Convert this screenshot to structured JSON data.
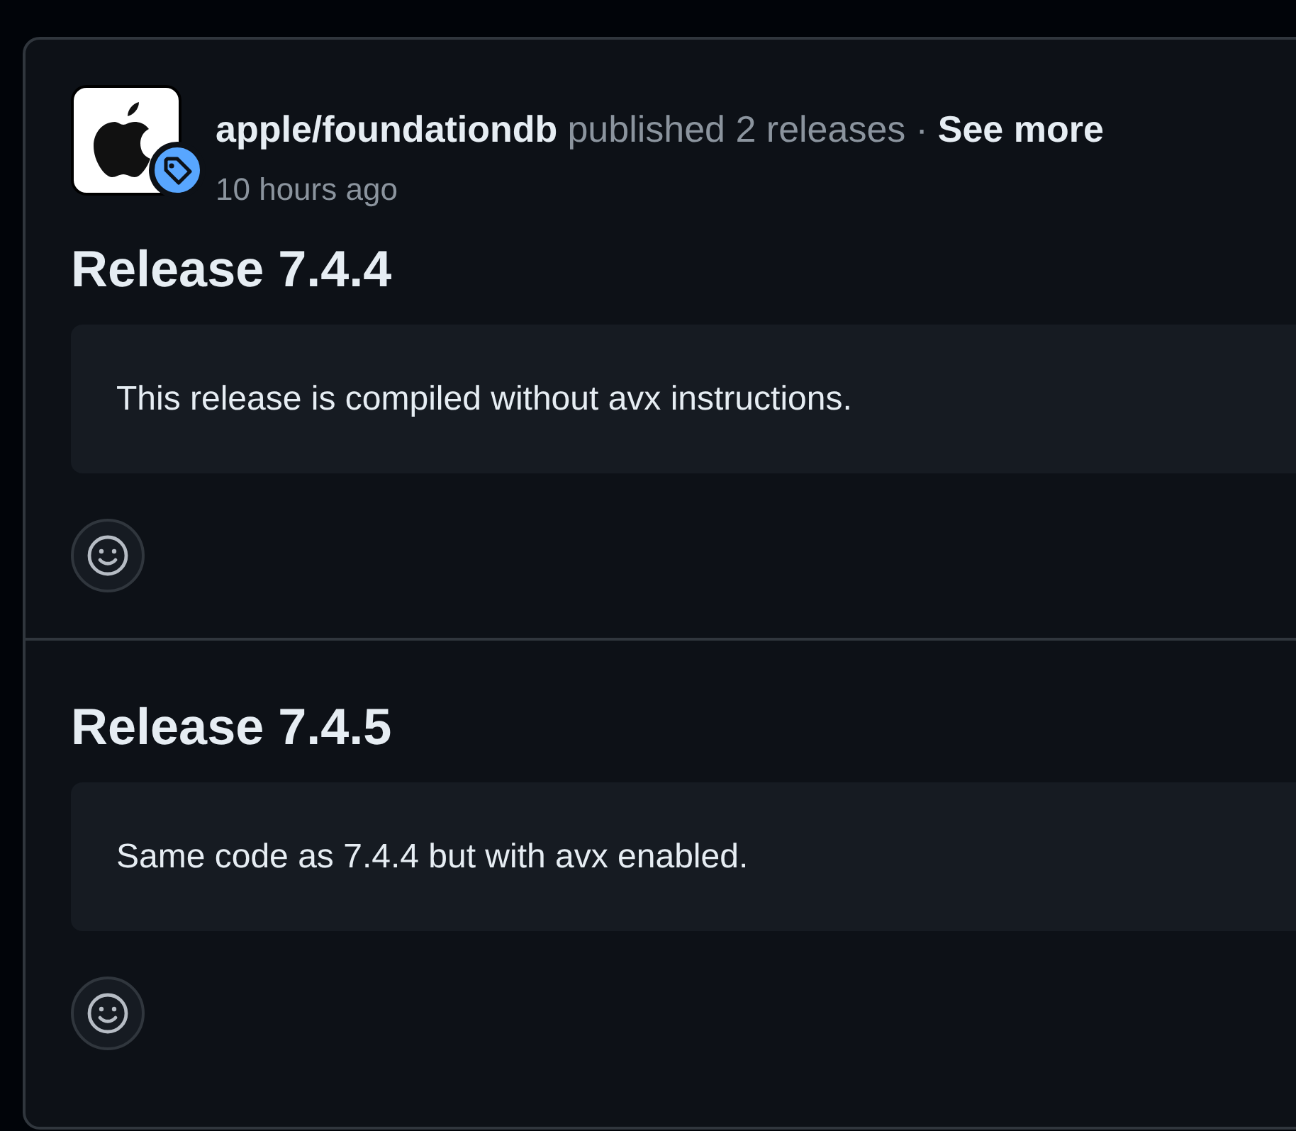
{
  "event": {
    "repo": "apple/foundationdb",
    "action": "published 2 releases",
    "separator": "·",
    "see_more": "See more",
    "time": "10 hours ago"
  },
  "releases": [
    {
      "title": "Release 7.4.4",
      "body": "This release is compiled without avx instructions."
    },
    {
      "title": "Release 7.4.5",
      "body": "Same code as 7.4.4 but with avx enabled."
    }
  ]
}
